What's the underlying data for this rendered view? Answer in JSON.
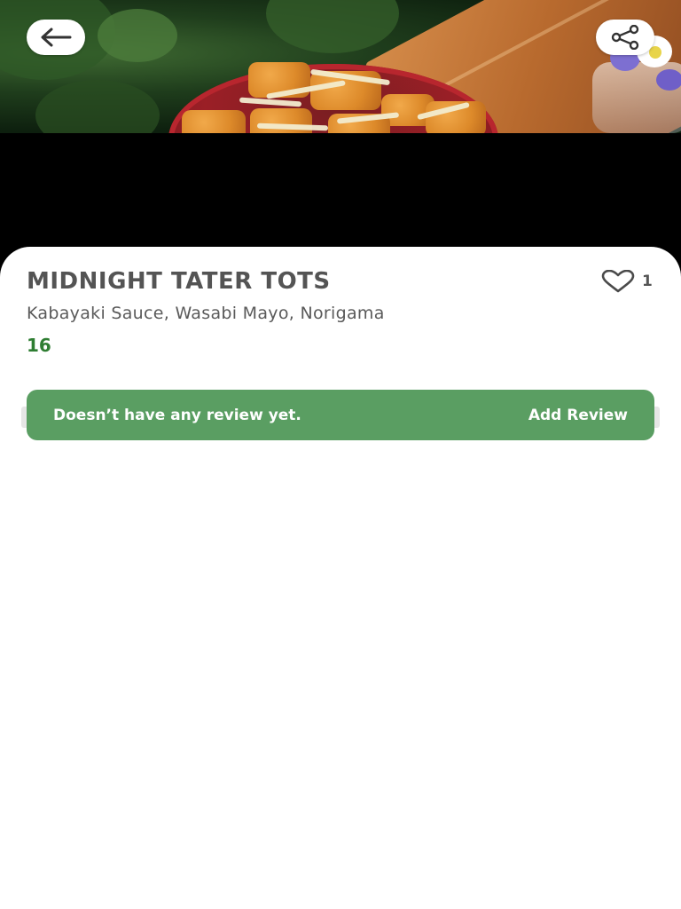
{
  "header": {
    "back_icon": "arrow-left-icon",
    "share_icon": "share-icon",
    "hero_image": "tater-tots-in-red-bowl"
  },
  "item": {
    "title": "MIDNIGHT TATER TOTS",
    "ingredients": "Kabayaki Sauce, Wasabi Mayo, Norigama",
    "price": "16",
    "like_count": "1",
    "like_icon": "heart-outline-icon"
  },
  "reviews": {
    "empty_message": "Doesn’t have any review yet.",
    "add_review_label": "Add Review"
  },
  "colors": {
    "accent_green": "#5a9e62",
    "price_green": "#2e7d32",
    "title_gray": "#545454",
    "bowl_red": "#9b1f26"
  }
}
